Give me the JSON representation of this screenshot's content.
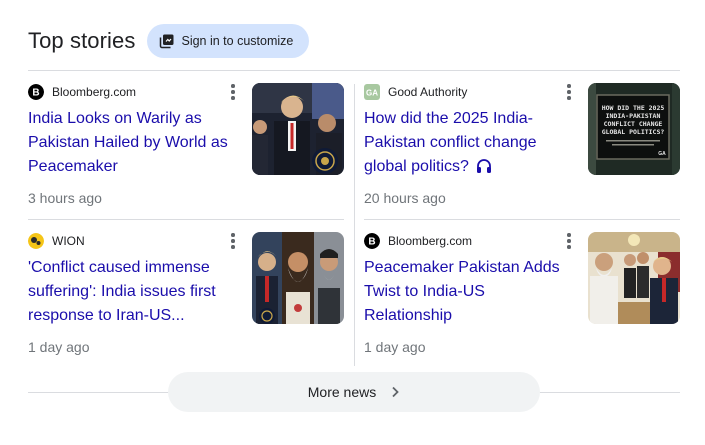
{
  "header": {
    "title": "Top stories",
    "signin_label": "Sign in to customize"
  },
  "stories": [
    {
      "source": "Bloomberg.com",
      "logo": "bloomberg-logo",
      "headline": "India Looks on Warily as Pakistan Hailed by World as Peacemaker",
      "time": "3 hours ago"
    },
    {
      "source": "Good Authority",
      "logo": "good-authority-logo",
      "headline": "How did the 2025 India-Pakistan conflict change global politics?",
      "has_audio_badge": true,
      "time": "20 hours ago",
      "thumb_text": "HOW DID THE 2025 INDIA-PAKISTAN CONFLICT CHANGE GLOBAL POLITICS?",
      "thumb_badge": "GA"
    },
    {
      "source": "WION",
      "logo": "wion-logo",
      "headline": "'Conflict caused immense suffering': India issues first response to Iran-US...",
      "time": "1 day ago"
    },
    {
      "source": "Bloomberg.com",
      "logo": "bloomberg-logo",
      "headline": "Peacemaker Pakistan Adds Twist to India-US Relationship",
      "time": "1 day ago"
    }
  ],
  "more_news_label": "More news",
  "colors": {
    "link": "#1a0dab",
    "signin_bg": "#d3e3fd",
    "divider": "#dadce0",
    "more_bg": "#f1f3f4"
  }
}
